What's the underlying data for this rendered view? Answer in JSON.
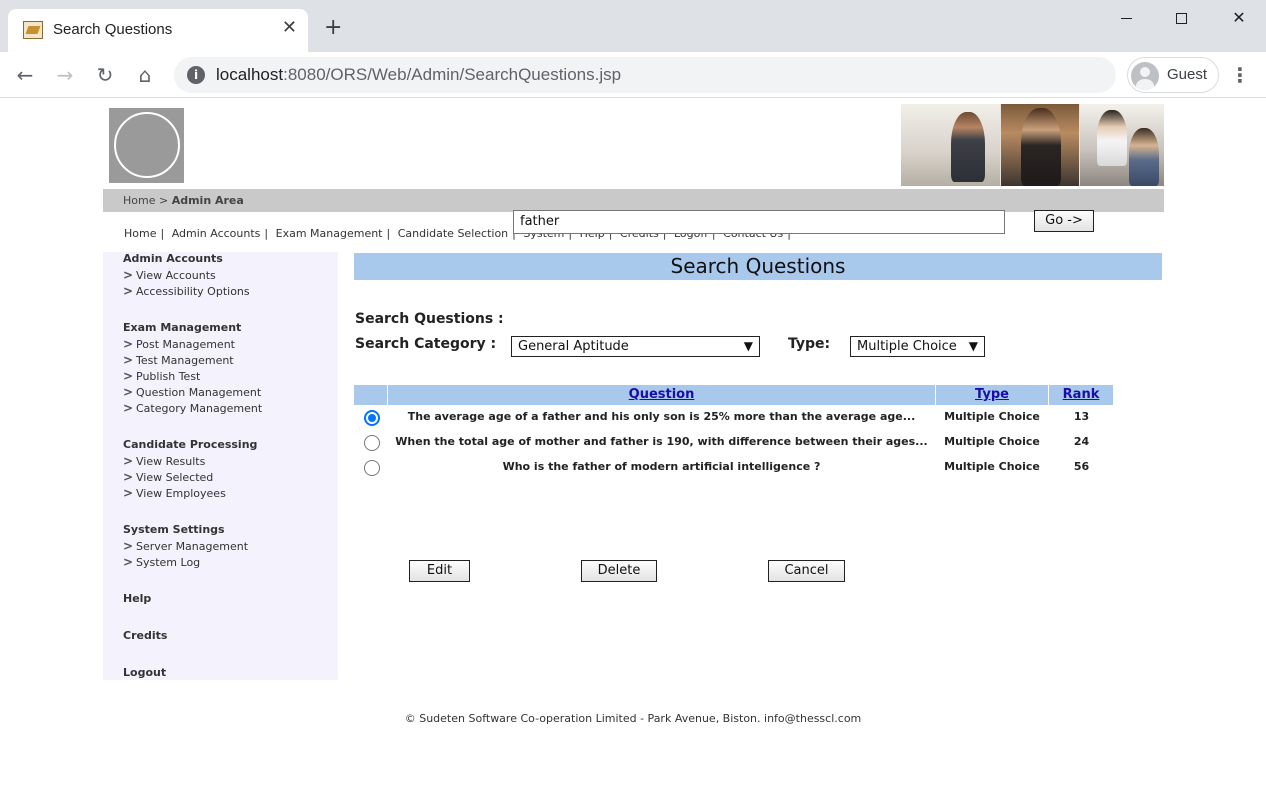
{
  "browser": {
    "tab_title": "Search Questions",
    "tab_close": "✕",
    "new_tab": "+",
    "url_host": "localhost",
    "url_rest": ":8080/ORS/Web/Admin/SearchQuestions.jsp",
    "profile_name": "Guest"
  },
  "breadcrumb": {
    "home": "Home",
    "separator": ">",
    "current": "Admin Area"
  },
  "topnav": [
    "Home",
    "Admin Accounts",
    "Exam Management",
    "Candidate Selection",
    "System",
    "Help",
    "Credits",
    "Logoff",
    "Contact Us"
  ],
  "sidebar": {
    "sections": [
      {
        "title": "Admin Accounts",
        "items": [
          "View Accounts",
          "Accessibility Options"
        ]
      },
      {
        "title": "Exam Management",
        "items": [
          "Post Management",
          "Test Management",
          "Publish Test",
          "Question Management",
          "Category Management"
        ]
      },
      {
        "title": "Candidate Processing",
        "items": [
          "View Results",
          "View Selected",
          "View Employees"
        ]
      },
      {
        "title": "System Settings",
        "items": [
          "Server Management",
          "System Log"
        ]
      },
      {
        "title": "Help",
        "items": []
      },
      {
        "title": "Credits",
        "items": []
      },
      {
        "title": "Logout",
        "items": []
      }
    ]
  },
  "main": {
    "title": "Search Questions",
    "search_label": "Search Questions :",
    "search_value": "father",
    "go_label": "Go ->",
    "category_label": "Search Category :",
    "category_value": "General Aptitude",
    "type_label": "Type:",
    "type_value": "Multiple Choice"
  },
  "table": {
    "columns": [
      "Question",
      "Type",
      "Rank"
    ],
    "rows": [
      {
        "question": "The average age of a father and his only son is 25% more than the average age...",
        "type": "Multiple Choice",
        "rank": "13",
        "selected": true
      },
      {
        "question": "When the total age of mother and father is 190, with difference between their ages...",
        "type": "Multiple Choice",
        "rank": "24",
        "selected": false
      },
      {
        "question": "Who is the father of modern artificial intelligence ?",
        "type": "Multiple Choice",
        "rank": "56",
        "selected": false
      }
    ]
  },
  "actions": {
    "edit": "Edit",
    "delete": "Delete",
    "cancel": "Cancel"
  },
  "footer": "© Sudeten Software Co-operation Limited - Park Avenue, Biston. info@thesscl.com",
  "colors": {
    "header_blue": "#a9c9ec",
    "sidebar_bg": "#f3f2fd",
    "crumb_bar": "#c9c9c9",
    "radio_checked": "#0075ff"
  }
}
